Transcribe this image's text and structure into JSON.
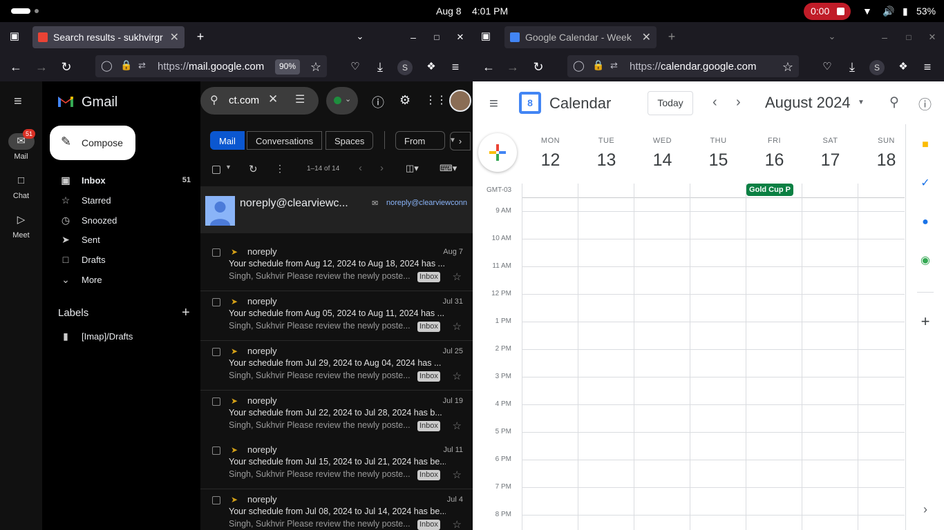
{
  "topbar": {
    "date": "Aug 8",
    "time": "4:01 PM",
    "recording": "0:00",
    "battery": "53%"
  },
  "gmail_window": {
    "tab_title": "Search results - sukhvirgr",
    "url_prefix": "https://",
    "url_host": "mail.google.com",
    "zoom": "90%",
    "rail": [
      {
        "label": "Mail",
        "badge": "51"
      },
      {
        "label": "Chat"
      },
      {
        "label": "Meet"
      }
    ],
    "app_name": "Gmail",
    "compose": "Compose",
    "nav": [
      {
        "label": "Inbox",
        "count": "51"
      },
      {
        "label": "Starred"
      },
      {
        "label": "Snoozed"
      },
      {
        "label": "Sent"
      },
      {
        "label": "Drafts"
      },
      {
        "label": "More"
      }
    ],
    "labels_title": "Labels",
    "labels": [
      "[Imap]/Drafts"
    ],
    "search_value": "ct.com",
    "chips": [
      "Mail",
      "Conversations",
      "Spaces",
      "From"
    ],
    "range": "1–14 of 14",
    "sender_card": {
      "name": "noreply@clearviewc...",
      "email": "noreply@clearviewconn"
    },
    "emails": [
      {
        "from": "noreply",
        "date": "Aug 7",
        "subject": "Your schedule from Aug 12, 2024 to Aug 18, 2024 has ...",
        "snippet": "Singh, Sukhvir Please review the newly poste...",
        "tag": "Inbox"
      },
      {
        "from": "noreply",
        "date": "Jul 31",
        "subject": "Your schedule from Aug 05, 2024 to Aug 11, 2024 has ...",
        "snippet": "Singh, Sukhvir Please review the newly poste...",
        "tag": "Inbox"
      },
      {
        "from": "noreply",
        "date": "Jul 25",
        "subject": "Your schedule from Jul 29, 2024 to Aug 04, 2024 has ...",
        "snippet": "Singh, Sukhvir Please review the newly poste...",
        "tag": "Inbox"
      },
      {
        "from": "noreply",
        "date": "Jul 19",
        "subject": "Your schedule from Jul 22, 2024 to Jul 28, 2024 has b...",
        "snippet": "Singh, Sukhvir Please review the newly poste...",
        "tag": "Inbox"
      },
      {
        "from": "noreply",
        "date": "Jul 11",
        "subject": "Your schedule from Jul 15, 2024 to Jul 21, 2024 has be...",
        "snippet": "Singh, Sukhvir Please review the newly poste...",
        "tag": "Inbox"
      },
      {
        "from": "noreply",
        "date": "Jul 4",
        "subject": "Your schedule from Jul 08, 2024 to Jul 14, 2024 has be...",
        "snippet": "Singh, Sukhvir Please review the newly poste...",
        "tag": "Inbox"
      }
    ]
  },
  "calendar_window": {
    "tab_title": "Google Calendar - Week",
    "url_prefix": "https://",
    "url_host": "calendar.google.com",
    "app_name": "Calendar",
    "logo_day": "8",
    "today": "Today",
    "month": "August 2024",
    "timezone": "GMT-03",
    "days": [
      {
        "name": "MON",
        "date": "12"
      },
      {
        "name": "TUE",
        "date": "13"
      },
      {
        "name": "WED",
        "date": "14"
      },
      {
        "name": "THU",
        "date": "15"
      },
      {
        "name": "FRI",
        "date": "16"
      },
      {
        "name": "SAT",
        "date": "17"
      },
      {
        "name": "SUN",
        "date": "18"
      }
    ],
    "event": {
      "title": "Gold Cup P",
      "day_index": 4,
      "color": "#0b8043"
    },
    "hours": [
      "9 AM",
      "10 AM",
      "11 AM",
      "12 PM",
      "1 PM",
      "2 PM",
      "3 PM",
      "4 PM",
      "5 PM",
      "6 PM",
      "7 PM",
      "8 PM"
    ]
  },
  "colors": {
    "gmail_chip_active": "#0b57d0",
    "recording": "#c01c28",
    "event": "#0b8043"
  }
}
